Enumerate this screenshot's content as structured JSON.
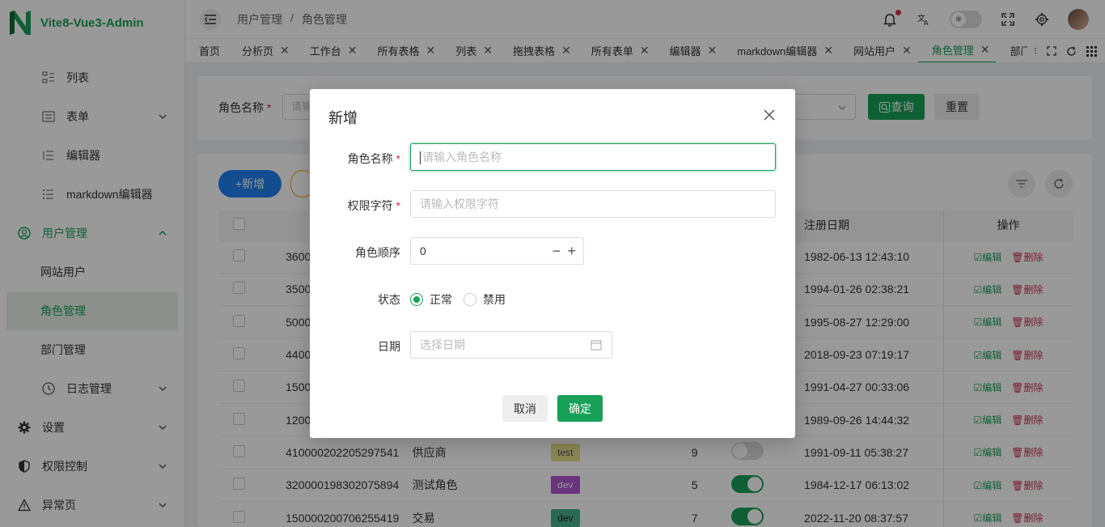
{
  "app": {
    "title": "Vite8-Vue3-Admin",
    "accent": "#18a058"
  },
  "sidebar": {
    "items": [
      {
        "label": "列表",
        "icon": "list-icon"
      },
      {
        "label": "表单",
        "icon": "form-icon"
      },
      {
        "label": "编辑器",
        "icon": "editor-icon"
      },
      {
        "label": "markdown编辑器",
        "icon": "markdown-icon"
      },
      {
        "label": "用户管理",
        "icon": "user-icon"
      },
      {
        "label": "网站用户"
      },
      {
        "label": "角色管理"
      },
      {
        "label": "部门管理"
      },
      {
        "label": "日志管理",
        "icon": "clock-icon"
      },
      {
        "label": "设置",
        "icon": "gear-icon"
      },
      {
        "label": "权限控制",
        "icon": "shield-icon"
      },
      {
        "label": "异常页",
        "icon": "warning-icon"
      }
    ]
  },
  "header": {
    "breadcrumb": [
      "用户管理",
      "/",
      "角色管理"
    ]
  },
  "tabs": [
    "首页",
    "分析页",
    "工作台",
    "所有表格",
    "列表",
    "拖拽表格",
    "所有表单",
    "编辑器",
    "markdown编辑器",
    "网站用户",
    "角色管理",
    "部门管理"
  ],
  "search": {
    "label": "角色名称",
    "placeholder": "请输",
    "query_label": "查询",
    "reset_label": "重置"
  },
  "table": {
    "add_label": "+新增",
    "headers": {
      "date": "注册日期",
      "ops": "操作"
    },
    "edit_label": "编辑",
    "delete_label": "删除",
    "rows": [
      {
        "id": "3600",
        "name": "",
        "tag": "",
        "num": "",
        "switch": "",
        "date": "1982-06-13 12:43:10"
      },
      {
        "id": "3500",
        "name": "",
        "tag": "",
        "num": "",
        "switch": "",
        "date": "1994-01-26 02:38:21"
      },
      {
        "id": "5000",
        "name": "",
        "tag": "",
        "num": "",
        "switch": "",
        "date": "1995-08-27 12:29:00"
      },
      {
        "id": "4400",
        "name": "",
        "tag": "",
        "num": "",
        "switch": "",
        "date": "2018-09-23 07:19:17"
      },
      {
        "id": "1500",
        "name": "",
        "tag": "",
        "num": "",
        "switch": "",
        "date": "1991-04-27 00:33:06"
      },
      {
        "id": "1200",
        "name": "",
        "tag": "",
        "num": "",
        "switch": "",
        "date": "1989-09-26 14:44:32"
      },
      {
        "id": "410000202205297541",
        "name": "供应商",
        "tag": "test",
        "num": "9",
        "switch": "off",
        "date": "1991-09-11 05:38:27"
      },
      {
        "id": "320000198302075894",
        "name": "测试角色",
        "tag": "dev",
        "num": "5",
        "switch": "on",
        "date": "1984-12-17 06:13:02"
      },
      {
        "id": "150000200706255419",
        "name": "交易",
        "tag": "dev",
        "num": "7",
        "switch": "on",
        "date": "2022-11-20 08:37:57"
      }
    ]
  },
  "modal": {
    "title": "新增",
    "fields": {
      "name_label": "角色名称",
      "name_placeholder": "请输入角色名称",
      "code_label": "权限字符",
      "code_placeholder": "请输入权限字符",
      "order_label": "角色顺序",
      "order_value": "0",
      "status_label": "状态",
      "status_options": [
        "正常",
        "禁用"
      ],
      "status_selected": "正常",
      "date_label": "日期",
      "date_placeholder": "选择日期"
    },
    "cancel_label": "取消",
    "ok_label": "确定"
  }
}
